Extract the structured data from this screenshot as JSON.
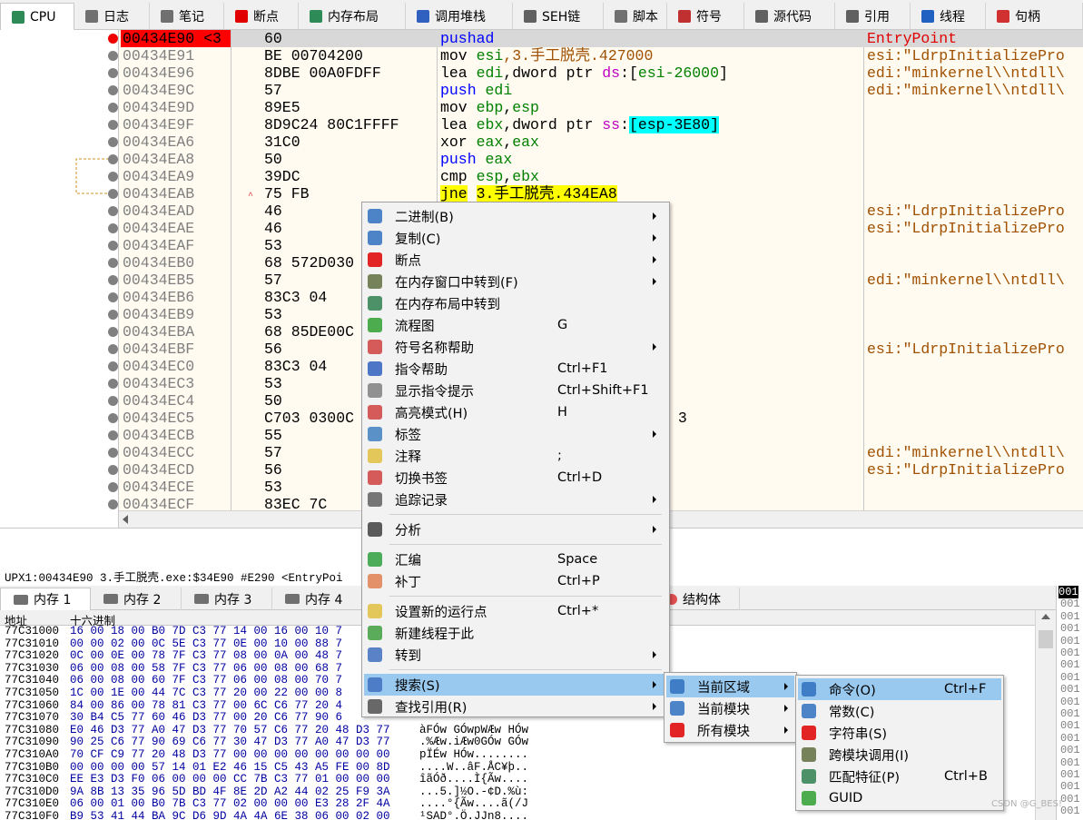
{
  "tabs": [
    {
      "label": "CPU",
      "icon": "cpu-icon",
      "color": "#2e8b57"
    },
    {
      "label": "日志",
      "icon": "log-icon",
      "color": "#707070"
    },
    {
      "label": "笔记",
      "icon": "notes-icon",
      "color": "#707070"
    },
    {
      "label": "断点",
      "icon": "breakpoint-icon",
      "color": "#e00000"
    },
    {
      "label": "内存布局",
      "icon": "memory-map-icon",
      "color": "#2e8b57"
    },
    {
      "label": "调用堆栈",
      "icon": "call-stack-icon",
      "color": "#3060c0"
    },
    {
      "label": "SEH链",
      "icon": "seh-icon",
      "color": "#606060"
    },
    {
      "label": "脚本",
      "icon": "script-icon",
      "color": "#707070"
    },
    {
      "label": "符号",
      "icon": "symbol-icon",
      "color": "#c03030"
    },
    {
      "label": "源代码",
      "icon": "source-icon",
      "color": "#606060"
    },
    {
      "label": "引用",
      "icon": "references-icon",
      "color": "#606060"
    },
    {
      "label": "线程",
      "icon": "threads-icon",
      "color": "#2060c0"
    },
    {
      "label": "句柄",
      "icon": "handles-icon",
      "color": "#d03030"
    }
  ],
  "disasm": {
    "rows": [
      {
        "addr": "00434E90 <3",
        "bytes": "60",
        "asm": [
          [
            "pushad",
            "kw"
          ]
        ],
        "cmt": "EntryPoint",
        "cur": true,
        "bp": true
      },
      {
        "addr": "00434E91",
        "bytes": "BE 00704200",
        "asm": [
          [
            "mov ",
            ""
          ],
          [
            "esi",
            "reg"
          ],
          [
            ",3.手工脱壳.427000",
            "str"
          ]
        ],
        "cmt": "esi:\"LdrpInitializePro"
      },
      {
        "addr": "00434E96",
        "bytes": "8DBE 00A0FDFF",
        "asm": [
          [
            "lea ",
            ""
          ],
          [
            "edi",
            "reg"
          ],
          [
            ",dword ptr ",
            ""
          ],
          [
            "ds",
            "seg"
          ],
          [
            ":[",
            ""
          ],
          [
            "esi-26000",
            "reg"
          ],
          [
            "]",
            ""
          ]
        ],
        "cmt": "edi:\"minkernel\\\\ntdll\\"
      },
      {
        "addr": "00434E9C",
        "bytes": "57",
        "asm": [
          [
            "push ",
            "kw"
          ],
          [
            "edi",
            "reg"
          ]
        ],
        "cmt": "edi:\"minkernel\\\\ntdll\\"
      },
      {
        "addr": "00434E9D",
        "bytes": "89E5",
        "asm": [
          [
            "mov ",
            ""
          ],
          [
            "ebp",
            "reg"
          ],
          [
            ",",
            ""
          ],
          [
            "esp",
            "reg"
          ]
        ],
        "cmt": ""
      },
      {
        "addr": "00434E9F",
        "bytes": "8D9C24 80C1FFFF",
        "asm": [
          [
            "lea ",
            ""
          ],
          [
            "ebx",
            "reg"
          ],
          [
            ",dword ptr ",
            ""
          ],
          [
            "ss",
            "seg"
          ],
          [
            ":",
            ""
          ],
          [
            "[esp-3E80]",
            "brk"
          ]
        ],
        "cmt": ""
      },
      {
        "addr": "00434EA6",
        "bytes": "31C0",
        "asm": [
          [
            "xor ",
            ""
          ],
          [
            "eax",
            "reg"
          ],
          [
            ",",
            ""
          ],
          [
            "eax",
            "reg"
          ]
        ],
        "cmt": ""
      },
      {
        "addr": "00434EA8",
        "bytes": "50",
        "asm": [
          [
            "push ",
            "kw"
          ],
          [
            "eax",
            "reg"
          ]
        ],
        "cmt": ""
      },
      {
        "addr": "00434EA9",
        "bytes": "39DC",
        "asm": [
          [
            "cmp ",
            ""
          ],
          [
            "esp",
            "reg"
          ],
          [
            ",",
            ""
          ],
          [
            "ebx",
            "reg"
          ]
        ],
        "cmt": ""
      },
      {
        "addr": "00434EAB",
        "bytes": "75 FB",
        "asm": [
          [
            "jne",
            "jmp"
          ],
          [
            " ",
            ""
          ],
          [
            "3.手工脱壳.434EA8",
            "jmp"
          ]
        ],
        "cmt": ""
      },
      {
        "addr": "00434EAD",
        "bytes": "46",
        "asm": [],
        "cmt": "esi:\"LdrpInitializePro"
      },
      {
        "addr": "00434EAE",
        "bytes": "46",
        "asm": [],
        "cmt": "esi:\"LdrpInitializePro"
      },
      {
        "addr": "00434EAF",
        "bytes": "53",
        "asm": [],
        "cmt": ""
      },
      {
        "addr": "00434EB0",
        "bytes": "68 572D030",
        "asm": [],
        "cmt": ""
      },
      {
        "addr": "00434EB5",
        "bytes": "57",
        "asm": [],
        "cmt": "edi:\"minkernel\\\\ntdll\\"
      },
      {
        "addr": "00434EB6",
        "bytes": "83C3 04",
        "asm": [],
        "cmt": ""
      },
      {
        "addr": "00434EB9",
        "bytes": "53",
        "asm": [],
        "cmt": ""
      },
      {
        "addr": "00434EBA",
        "bytes": "68 85DE00C",
        "asm": [],
        "cmt": ""
      },
      {
        "addr": "00434EBF",
        "bytes": "56",
        "asm": [],
        "cmt": "esi:\"LdrpInitializePro"
      },
      {
        "addr": "00434EC0",
        "bytes": "83C3 04",
        "asm": [],
        "cmt": ""
      },
      {
        "addr": "00434EC3",
        "bytes": "53",
        "asm": [],
        "cmt": ""
      },
      {
        "addr": "00434EC4",
        "bytes": "50",
        "asm": [],
        "cmt": ""
      },
      {
        "addr": "00434EC5",
        "bytes": "C703 0300C",
        "asm": [
          [
            " 3",
            ""
          ]
        ],
        "asmx": 737,
        "cmt": ""
      },
      {
        "addr": "00434ECB",
        "bytes": "55",
        "asm": [],
        "cmt": ""
      },
      {
        "addr": "00434ECC",
        "bytes": "57",
        "asm": [],
        "cmt": "edi:\"minkernel\\\\ntdll\\"
      },
      {
        "addr": "00434ECD",
        "bytes": "56",
        "asm": [],
        "cmt": "esi:\"LdrpInitializePro"
      },
      {
        "addr": "00434ECE",
        "bytes": "53",
        "asm": [],
        "cmt": ""
      },
      {
        "addr": "00434ECF",
        "bytes": "83EC 7C",
        "asm": [],
        "cmt": ""
      }
    ]
  },
  "infoline": "UPX1:00434E90 3.手工脱壳.exe:$34E90 #E290 <EntryPoi",
  "dump_tabs": [
    {
      "label": "内存 1",
      "icon": "dump-icon"
    },
    {
      "label": "内存 2",
      "icon": "dump-icon"
    },
    {
      "label": "内存 3",
      "icon": "dump-icon"
    },
    {
      "label": "内存 4",
      "icon": "dump-icon"
    },
    {
      "label": "结构体",
      "icon": "struct-icon"
    }
  ],
  "dump": {
    "col_addr": "地址",
    "col_hex": "十六进制",
    "rows": [
      {
        "addr": "77C31000",
        "hex": "16 00 18 00 B0 7D C3 77 14 00 16 00 10 7",
        "asc": ""
      },
      {
        "addr": "77C31010",
        "hex": "00 00 02 00 0C 5E C3 77 0E 00 10 00 88 7",
        "asc": ""
      },
      {
        "addr": "77C31020",
        "hex": "0C 00 0E 00 78 7F C3 77 08 00 0A 00 48 7",
        "asc": ""
      },
      {
        "addr": "77C31030",
        "hex": "06 00 08 00 58 7F C3 77 06 00 08 00 68 7",
        "asc": ""
      },
      {
        "addr": "77C31040",
        "hex": "06 00 08 00 60 7F C3 77 06 00 08 00 70 7",
        "asc": ""
      },
      {
        "addr": "77C31050",
        "hex": "1C 00 1E 00 44 7C C3 77 20 00 22 00 00 8",
        "asc": ""
      },
      {
        "addr": "77C31060",
        "hex": "84 00 86 00 78 81 C3 77 00 6C C6 77 20 4",
        "asc": ""
      },
      {
        "addr": "77C31070",
        "hex": "30 B4 C5 77 60 46 D3 77 00 20 C6 77 90 6",
        "asc": ""
      },
      {
        "addr": "77C31080",
        "hex": "E0 46 D3 77 A0 47 D3 77 70 57 C6 77 20 48 D3 77",
        "asc": "àFÓw GÓwpWÆw HÓw"
      },
      {
        "addr": "77C31090",
        "hex": "90 25 C6 77 90 69 C6 77 30 47 D3 77 A0 47 D3 77",
        "asc": ".%Æw.iÆw0GÓw GÓw"
      },
      {
        "addr": "77C310A0",
        "hex": "70 CF C9 77 20 48 D3 77 00 00 00 00 00 00 00 00",
        "asc": "pÏÉw HÓw........"
      },
      {
        "addr": "77C310B0",
        "hex": "00 00 00 00 57 14 01 E2 46 15 C5 43 A5 FE 00 8D",
        "asc": "....W..âF.ÅC¥þ.."
      },
      {
        "addr": "77C310C0",
        "hex": "EE E3 D3 F0 06 00 00 00 CC 7B C3 77 01 00 00 00",
        "asc": "îãÓð....Ì{Ãw...."
      },
      {
        "addr": "77C310D0",
        "hex": "9A 8B 13 35 96 5D BD 4F 8E 2D A2 44 02 25 F9 3A",
        "asc": "...5.]½O.-¢D.%ù:"
      },
      {
        "addr": "77C310E0",
        "hex": "06 00 01 00 B0 7B C3 77 02 00 00 00 E3 28 2F 4A",
        "asc": "....°{Ãw....ã(/J"
      },
      {
        "addr": "77C310F0",
        "hex": "B9 53 41 44 BA 9C D6 9D 4A 4A 6E 38 06 00 02 00",
        "asc": "¹SAD°.Ö.JJn8...."
      }
    ]
  },
  "stack_rows": [
    "001",
    "001",
    "001",
    "001",
    "001",
    "001",
    "001",
    "001",
    "001",
    "001",
    "001",
    "001",
    "001",
    "001",
    "001",
    "001",
    "001",
    "001",
    "001"
  ],
  "context_menu": {
    "items": [
      {
        "label": "二进制(B)",
        "shortcut": "",
        "sub": true,
        "icon": "binary-icon"
      },
      {
        "label": "复制(C)",
        "shortcut": "",
        "sub": true,
        "icon": "copy-icon"
      },
      {
        "label": "断点",
        "shortcut": "",
        "sub": true,
        "icon": "breakpoint-icon"
      },
      {
        "label": "在内存窗口中转到(F)",
        "shortcut": "",
        "sub": true,
        "icon": "follow-dump-icon"
      },
      {
        "label": "在内存布局中转到",
        "shortcut": "",
        "sub": false,
        "icon": "memory-map-icon"
      },
      {
        "label": "流程图",
        "shortcut": "G",
        "sub": false,
        "icon": "graph-icon"
      },
      {
        "label": "符号名称帮助",
        "shortcut": "",
        "sub": true,
        "icon": "help-ring-icon"
      },
      {
        "label": "指令帮助",
        "shortcut": "Ctrl+F1",
        "sub": false,
        "icon": "instr-help-icon"
      },
      {
        "label": "显示指令提示",
        "shortcut": "Ctrl+Shift+F1",
        "sub": false,
        "icon": "hint-icon"
      },
      {
        "label": "高亮模式(H)",
        "shortcut": "H",
        "sub": false,
        "icon": "highlight-icon"
      },
      {
        "label": "标签",
        "shortcut": "",
        "sub": true,
        "icon": "label-icon"
      },
      {
        "label": "注释",
        "shortcut": ";",
        "sub": false,
        "icon": "comment-icon"
      },
      {
        "label": "切换书签",
        "shortcut": "Ctrl+D",
        "sub": false,
        "icon": "bookmark-icon"
      },
      {
        "label": "追踪记录",
        "shortcut": "",
        "sub": true,
        "icon": "trace-icon"
      },
      {
        "sep": true
      },
      {
        "label": "分析",
        "shortcut": "",
        "sub": true,
        "icon": "analyze-icon"
      },
      {
        "sep": true
      },
      {
        "label": "汇编",
        "shortcut": "Space",
        "sub": false,
        "icon": "assemble-icon"
      },
      {
        "label": "补丁",
        "shortcut": "Ctrl+P",
        "sub": false,
        "icon": "patch-icon"
      },
      {
        "sep": true
      },
      {
        "label": "设置新的运行点",
        "shortcut": "Ctrl+*",
        "sub": false,
        "icon": "new-origin-icon"
      },
      {
        "label": "新建线程于此",
        "shortcut": "",
        "sub": false,
        "icon": "new-thread-icon"
      },
      {
        "label": "转到",
        "shortcut": "",
        "sub": true,
        "icon": "goto-icon"
      },
      {
        "sep": true
      },
      {
        "label": "搜索(S)",
        "shortcut": "",
        "sub": true,
        "icon": "search-icon",
        "hl": true
      },
      {
        "label": "查找引用(R)",
        "shortcut": "",
        "sub": true,
        "icon": "binoculars-icon"
      }
    ]
  },
  "search_submenu": {
    "items": [
      {
        "label": "当前区域",
        "sub": true,
        "icon": "search-region-icon",
        "hl": true
      },
      {
        "label": "当前模块",
        "sub": true,
        "icon": "search-module-icon"
      },
      {
        "label": "所有模块",
        "sub": true,
        "icon": "search-all-icon"
      }
    ]
  },
  "region_submenu": {
    "items": [
      {
        "label": "命令(O)",
        "shortcut": "Ctrl+F",
        "icon": "search-command-icon",
        "hl": true
      },
      {
        "label": "常数(C)",
        "shortcut": "",
        "icon": "search-constant-icon"
      },
      {
        "label": "字符串(S)",
        "shortcut": "",
        "icon": "search-string-icon"
      },
      {
        "label": "跨模块调用(I)",
        "shortcut": "",
        "icon": "intermodular-icon"
      },
      {
        "label": "匹配特征(P)",
        "shortcut": "Ctrl+B",
        "icon": "pattern-icon"
      },
      {
        "label": "GUID",
        "shortcut": "",
        "icon": "guid-icon"
      }
    ]
  },
  "watermark": "CSDN @G_BES!"
}
